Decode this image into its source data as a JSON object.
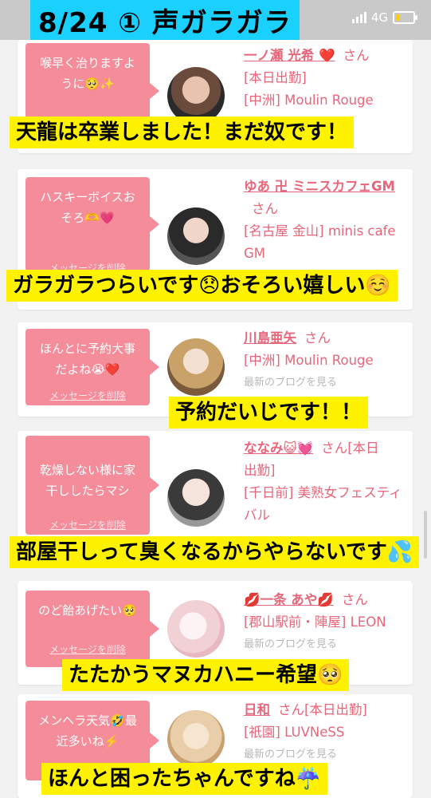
{
  "title": "8/24 ① 声ガラガラ",
  "status_bar": {
    "network": "4G"
  },
  "delete_label": "メッセージを削除",
  "san": "さん",
  "cards": [
    {
      "message": "喉早く治りますように🥺✨",
      "name": "一ノ瀬 光希 ❤️",
      "line1": "[本日出勤]",
      "line2": "[中洲] Moulin Rouge",
      "caption": "天龍は卒業しました！まだ奴です！"
    },
    {
      "message": "ハスキーボイスおそろ🫶💗",
      "name": "ゆあ 卍 ミニスカフェGM",
      "line1": "[名古屋 金山] minis cafe GM",
      "caption": "ガラガラつらいです😞おそろい嬉しい☺️"
    },
    {
      "message": "ほんとに予約大事だよね😭❤️",
      "name": "川島亜矢",
      "line1": "[中洲] Moulin Rouge",
      "blog": "最新のブログを見る",
      "caption": "予約だいじです！！"
    },
    {
      "message": "乾燥しない様に家干ししたらマシ",
      "name": "ななみ😺💓",
      "line1": "出勤]",
      "line1_pre": "[本日",
      "line2": "[千日前] 美熟女フェスティバル",
      "caption": "部屋干しって臭くなるからやらないです💦"
    },
    {
      "message": "のど飴あげたい🥺",
      "name": "💋一条 あや💋",
      "line1": "[郡山駅前・陣屋] LEON",
      "blog": "最新のブログを見る",
      "caption": "たたかうマヌカハニー希望🥺"
    },
    {
      "message": "メンヘラ天気🤣最近多いね⚡️",
      "name": "日和",
      "line1_pre": "[本日出勤]",
      "line1": "[祇園] LUVNeSS",
      "blog": "最新のブログを見る",
      "caption": "ほんと困ったちゃんですね☔️"
    }
  ]
}
